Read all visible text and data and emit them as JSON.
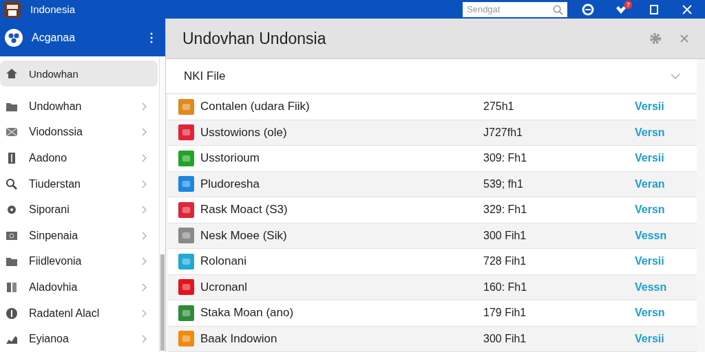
{
  "window": {
    "title": "Indonesia",
    "search": {
      "placeholder": "Sendgat"
    },
    "notification_badge": "7"
  },
  "sidebar": {
    "account": "Acganaa",
    "items": [
      {
        "label": "Undowhan",
        "selected": true,
        "chevron": false
      },
      {
        "label": "Undowhan",
        "selected": false,
        "chevron": true
      },
      {
        "label": "Viodonssia",
        "selected": false,
        "chevron": true
      },
      {
        "label": "Aadono",
        "selected": false,
        "chevron": true
      },
      {
        "label": "Tiuderstan",
        "selected": false,
        "chevron": true
      },
      {
        "label": "Siporani",
        "selected": false,
        "chevron": true
      },
      {
        "label": "Sinpenaia",
        "selected": false,
        "chevron": true
      },
      {
        "label": "Fiidlevonia",
        "selected": false,
        "chevron": true
      },
      {
        "label": "Aladovhia",
        "selected": false,
        "chevron": true
      },
      {
        "label": "Radatenl Alacl",
        "selected": false,
        "chevron": true
      },
      {
        "label": "Eyianoa",
        "selected": false,
        "chevron": true
      }
    ]
  },
  "panel": {
    "title": "Undovhan Undonsia",
    "section": {
      "label": "NKI File",
      "expanded": false
    },
    "rows": [
      {
        "name": "Contalen (udara Fiik)",
        "size": "275h1",
        "action": "Versii",
        "color": "#e08a1e"
      },
      {
        "name": "Usstowions (ole)",
        "size": "J727fh1",
        "action": "Versn",
        "color": "#e0243a"
      },
      {
        "name": "Usstorioum",
        "size": "309: Fh1",
        "action": "Versii",
        "color": "#23a32a"
      },
      {
        "name": "Pludoresha",
        "size": "539; fh1",
        "action": "Veran",
        "color": "#1d86e0"
      },
      {
        "name": "Rask Moact (S3)",
        "size": "329: Fh1",
        "action": "Versn",
        "color": "#e0243a"
      },
      {
        "name": "Nesk Moee (Sik)",
        "size": "300 Fih1",
        "action": "Vessn",
        "color": "#8a8a8a"
      },
      {
        "name": "Rolonani",
        "size": "728 Fih1",
        "action": "Versii",
        "color": "#21a8d8"
      },
      {
        "name": "Ucronanl",
        "size": "160: Fh1",
        "action": "Vessn",
        "color": "#e0161e"
      },
      {
        "name": "Staka Moan (ano)",
        "size": "179 Fih1",
        "action": "Versn",
        "color": "#2e8b3a"
      },
      {
        "name": "Baak Indowion",
        "size": "300 Fih1",
        "action": "Versii",
        "color": "#ee8c12"
      }
    ]
  }
}
